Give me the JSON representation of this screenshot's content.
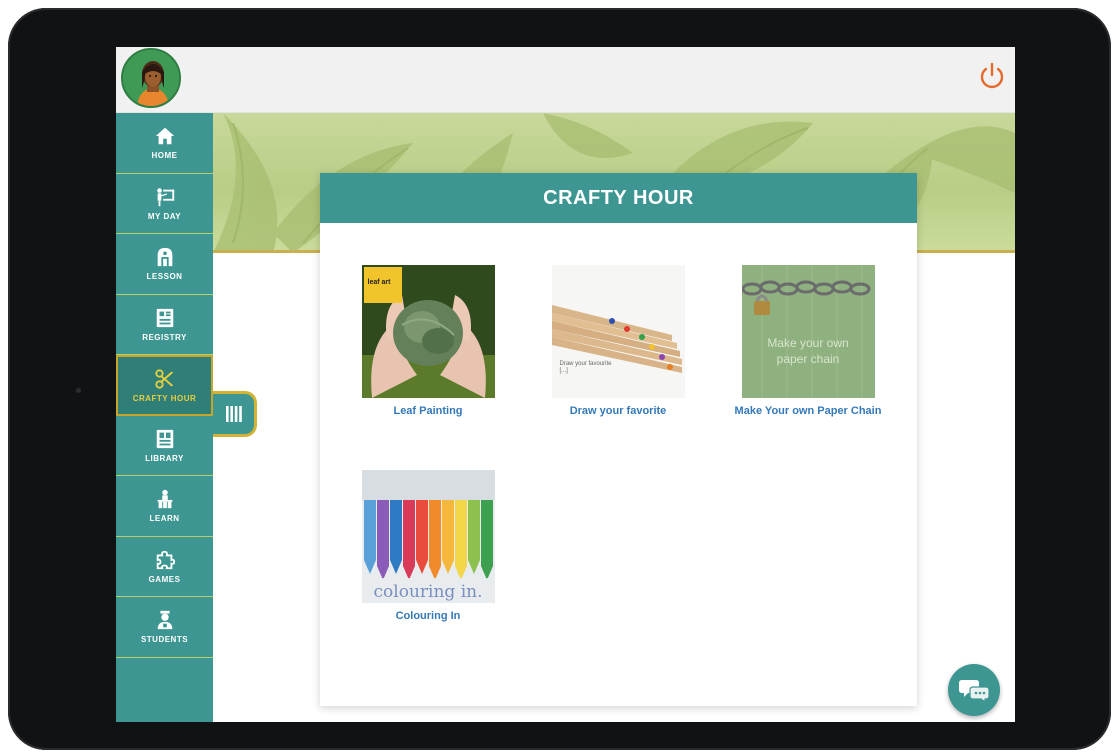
{
  "header": {
    "avatar_icon": "student-avatar",
    "power_icon": "power-icon",
    "accent_color": "#e46a2e"
  },
  "sidebar": {
    "items": [
      {
        "label": "HOME",
        "icon": "home-icon"
      },
      {
        "label": "MY DAY",
        "icon": "teacher-board-icon"
      },
      {
        "label": "LESSON",
        "icon": "lesson-icon"
      },
      {
        "label": "REGISTRY",
        "icon": "registry-icon"
      },
      {
        "label": "CRAFTY HOUR",
        "icon": "scissors-icon",
        "active": true
      },
      {
        "label": "LIBRARY",
        "icon": "library-icon"
      },
      {
        "label": "LEARN",
        "icon": "learn-icon"
      },
      {
        "label": "GAMES",
        "icon": "puzzle-icon"
      },
      {
        "label": "STUDENTS",
        "icon": "student-icon"
      }
    ],
    "bg_color": "#3d9692",
    "active_color": "#e4cf3f"
  },
  "main": {
    "title": "CRAFTY HOUR",
    "activities": [
      {
        "label": "Leaf Painting",
        "badge": "leaf art"
      },
      {
        "label": "Draw your favorite",
        "thumb_caption": "Draw your favourite [...]"
      },
      {
        "label": "Make Your own Paper Chain",
        "thumb_caption": "Make your own paper chain"
      },
      {
        "label": "Colouring In",
        "thumb_caption": "colouring in."
      }
    ]
  },
  "chat": {
    "icon": "chat-bubbles-icon"
  }
}
